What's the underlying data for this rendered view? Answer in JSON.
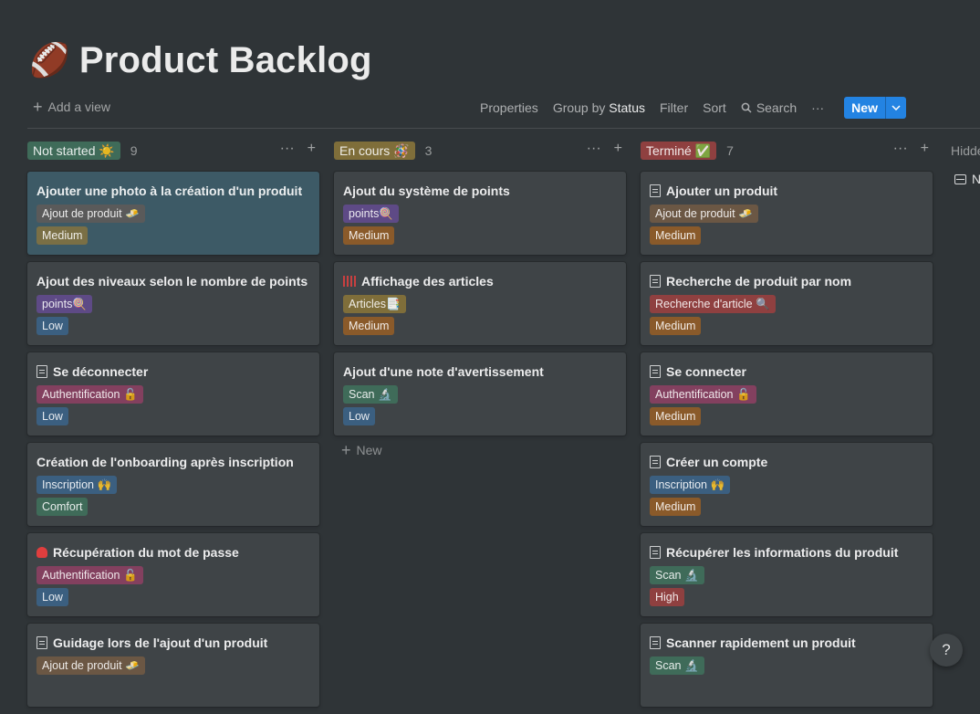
{
  "page": {
    "emoji": "🏈",
    "title": "Product Backlog"
  },
  "toolbar": {
    "add_view": "Add a view",
    "properties": "Properties",
    "group_by_prefix": "Group by",
    "group_by_value": "Status",
    "filter": "Filter",
    "sort": "Sort",
    "search": "Search",
    "more": "···",
    "new": "New"
  },
  "colors": {
    "gray_tag": "#5a5a5a",
    "brown_tag": "#6b5744",
    "orange_tag": "#8a5a2a",
    "yellow_tag": "#7f6e3a",
    "green_tag": "#3f6b59",
    "blue_tag": "#3b5f80",
    "purple_tag": "#5e4a86",
    "pink_tag": "#83405f",
    "red_tag": "#8f4040",
    "not_started": "#3f6b59",
    "en_cours": "#7f6e3a",
    "termine": "#8f4040"
  },
  "columns": [
    {
      "status": "Not started ☀️",
      "count": "9",
      "color": "#3f6b59",
      "cards": [
        {
          "icon": "",
          "title": "Ajouter une photo à la création d'un produit",
          "highlight": true,
          "tags": [
            {
              "label": "Ajout de produit 🧈",
              "color": "#5a5a5a"
            },
            {
              "label": "Medium",
              "color": "#7a6f45"
            }
          ]
        },
        {
          "icon": "",
          "title": "Ajout des niveaux selon le nombre de points",
          "tags": [
            {
              "label": "points🍭",
              "color": "#5e4a86"
            },
            {
              "label": "Low",
              "color": "#3b5f80"
            }
          ]
        },
        {
          "icon": "doc",
          "title": "Se déconnecter",
          "tags": [
            {
              "label": "Authentification 🔓",
              "color": "#83405f"
            },
            {
              "label": "Low",
              "color": "#3b5f80"
            }
          ]
        },
        {
          "icon": "",
          "title": "Création de l'onboarding après inscription",
          "tags": [
            {
              "label": "Inscription 🙌",
              "color": "#3b5f80"
            },
            {
              "label": "Comfort",
              "color": "#3f6b59"
            }
          ]
        },
        {
          "icon": "blob",
          "title": "Récupération du mot de passe",
          "tags": [
            {
              "label": "Authentification 🔓",
              "color": "#83405f"
            },
            {
              "label": "Low",
              "color": "#3b5f80"
            }
          ]
        },
        {
          "icon": "doc",
          "title": "Guidage lors de l'ajout d'un produit",
          "tags": [
            {
              "label": "Ajout de produit 🧈",
              "color": "#6b5744"
            }
          ]
        }
      ]
    },
    {
      "status": "En cours 🪅",
      "count": "3",
      "color": "#7f6e3a",
      "cards": [
        {
          "icon": "",
          "title": "Ajout du système de points",
          "tags": [
            {
              "label": "points🍭",
              "color": "#5e4a86"
            },
            {
              "label": "Medium",
              "color": "#8a5a2a"
            }
          ]
        },
        {
          "icon": "bars",
          "title": "Affichage des articles",
          "tags": [
            {
              "label": "Articles📑",
              "color": "#7f6e3a"
            },
            {
              "label": "Medium",
              "color": "#8a5a2a"
            }
          ]
        },
        {
          "icon": "",
          "title": "Ajout d'une note d'avertissement",
          "tags": [
            {
              "label": "Scan 🔬",
              "color": "#3f6b59"
            },
            {
              "label": "Low",
              "color": "#3b5f80"
            }
          ]
        }
      ],
      "new_label": "New"
    },
    {
      "status": "Terminé ✅",
      "count": "7",
      "color": "#8f4040",
      "cards": [
        {
          "icon": "doc",
          "title": "Ajouter un produit",
          "tags": [
            {
              "label": "Ajout de produit 🧈",
              "color": "#6b5744"
            },
            {
              "label": "Medium",
              "color": "#8a5a2a"
            }
          ]
        },
        {
          "icon": "doc",
          "title": "Recherche de produit par nom",
          "tags": [
            {
              "label": "Recherche d'article 🔍",
              "color": "#8f4040"
            },
            {
              "label": "Medium",
              "color": "#8a5a2a"
            }
          ]
        },
        {
          "icon": "doc",
          "title": "Se connecter",
          "tags": [
            {
              "label": "Authentification 🔓",
              "color": "#83405f"
            },
            {
              "label": "Medium",
              "color": "#8a5a2a"
            }
          ]
        },
        {
          "icon": "doc",
          "title": "Créer un compte",
          "tags": [
            {
              "label": "Inscription 🙌",
              "color": "#3b5f80"
            },
            {
              "label": "Medium",
              "color": "#8a5a2a"
            }
          ]
        },
        {
          "icon": "doc",
          "title": "Récupérer les informations du produit",
          "tags": [
            {
              "label": "Scan 🔬",
              "color": "#3f6b59"
            },
            {
              "label": "High",
              "color": "#8f4040"
            }
          ]
        },
        {
          "icon": "doc",
          "title": "Scanner rapidement un produit",
          "tags": [
            {
              "label": "Scan 🔬",
              "color": "#3f6b59"
            }
          ]
        }
      ]
    }
  ],
  "hidden": {
    "label": "Hidde",
    "item": "N"
  },
  "help": "?"
}
